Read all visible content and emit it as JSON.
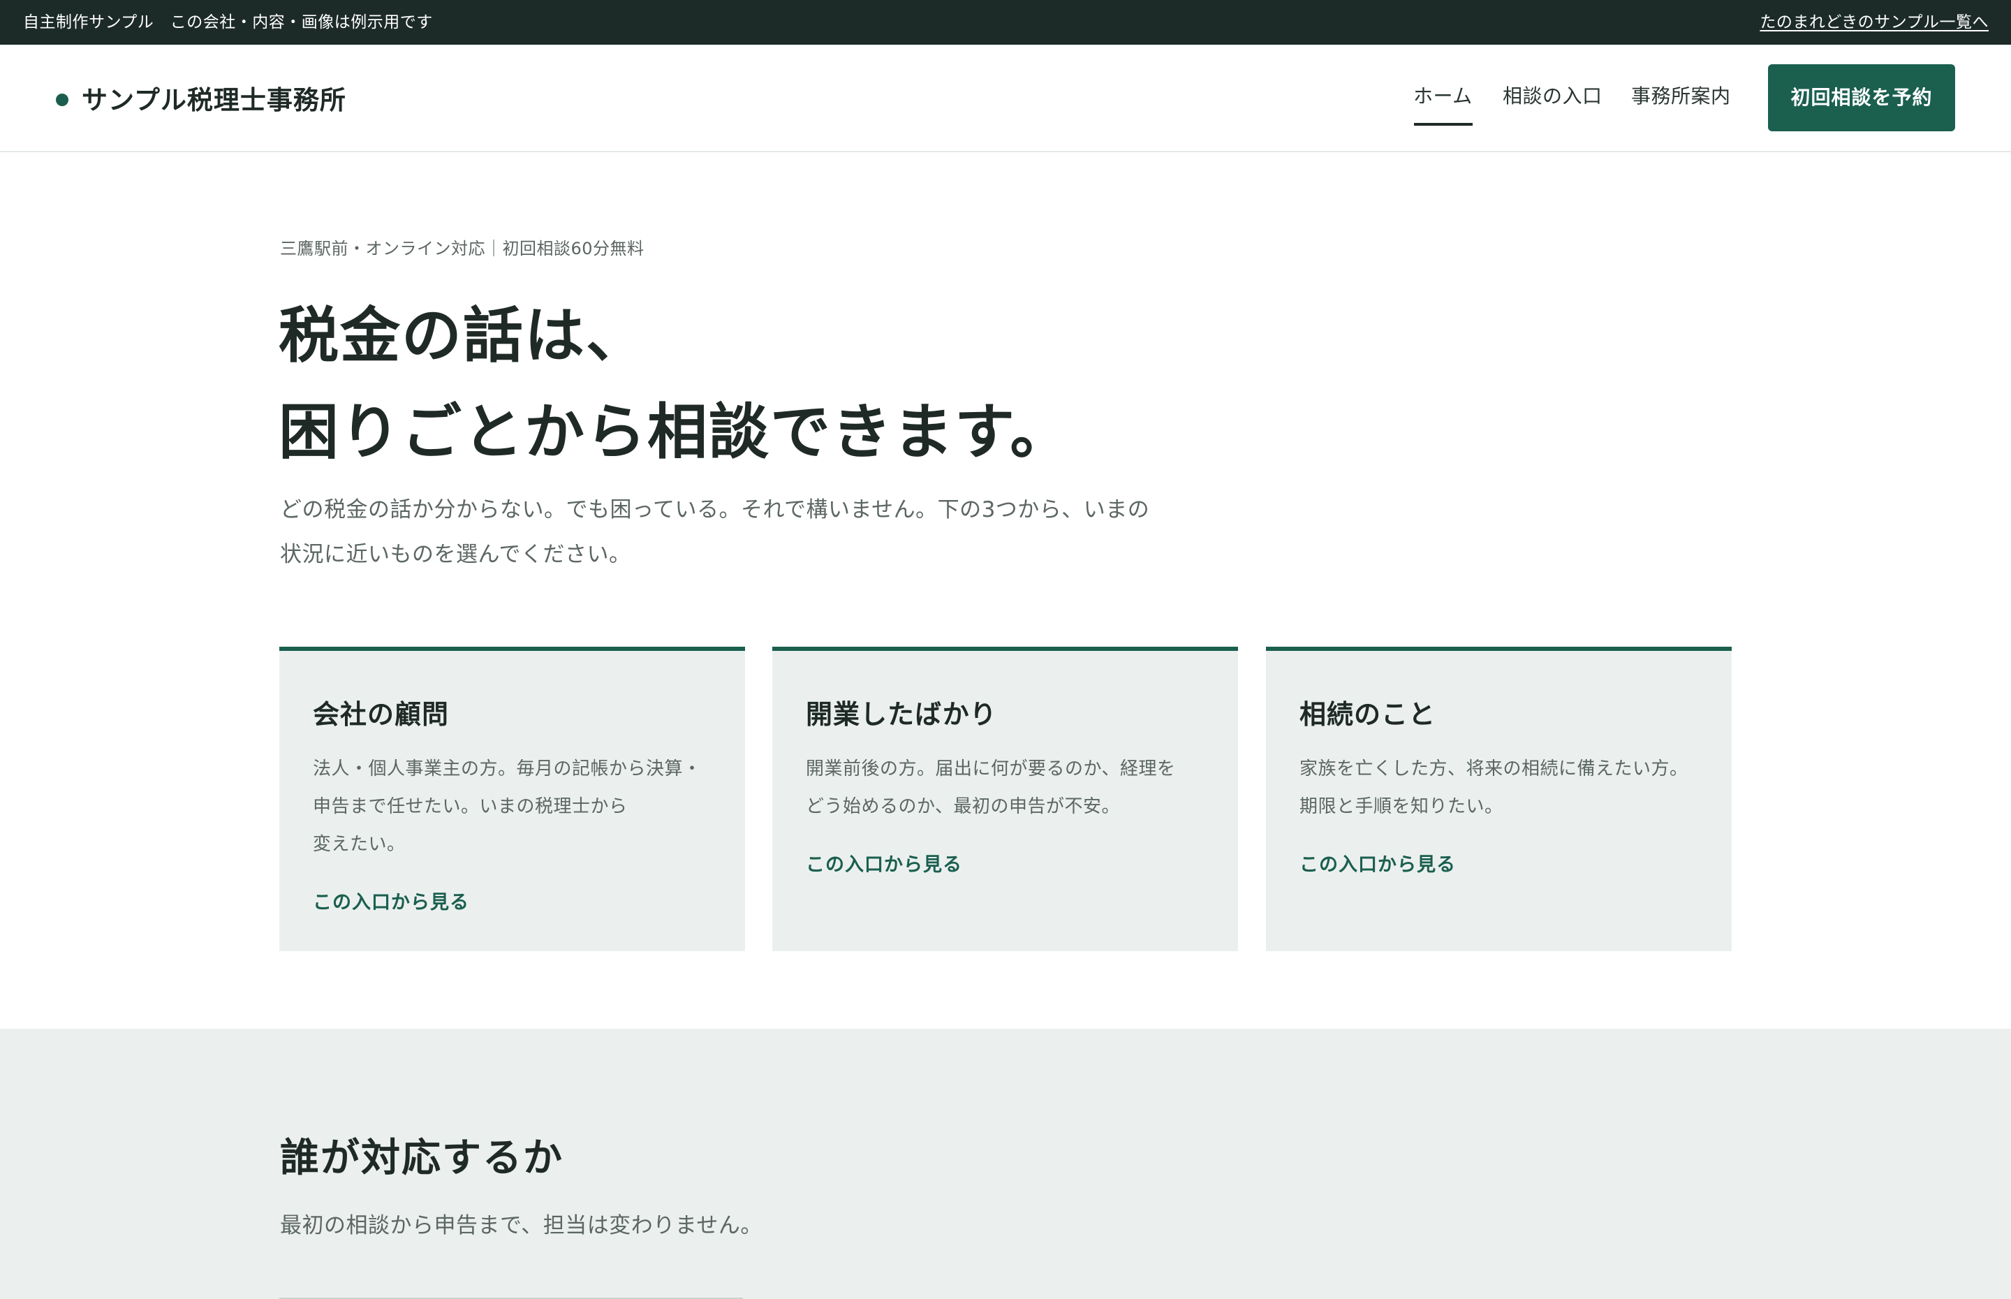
{
  "notice_bar": {
    "text": "自主制作サンプル　この会社・内容・画像は例示用です",
    "link_label": "たのまれどきのサンプル一覧へ"
  },
  "header": {
    "brand_name": "サンプル税理士事務所",
    "nav": [
      {
        "label": "ホーム",
        "active": true
      },
      {
        "label": "相談の入口",
        "active": false
      },
      {
        "label": "事務所案内",
        "active": false
      }
    ],
    "cta_label": "初回相談を予約"
  },
  "hero": {
    "eyebrow": "三鷹駅前・オンライン対応｜初回相談60分無料",
    "title_lines": [
      "税金の話は、",
      "困りごとから相談できます。"
    ],
    "lead_lines": [
      "どの税金の話か分からない。でも困っている。それで構いません。下の3つから、いまの",
      "状況に近いものを選んでください。"
    ]
  },
  "cards": [
    {
      "title": "会社の顧問",
      "desc_lines": [
        "法人・個人事業主の方。毎月の記帳から決算・",
        "申告まで任せたい。いまの税理士から",
        "変えたい。"
      ],
      "link": "この入口から見る"
    },
    {
      "title": "開業したばかり",
      "desc_lines": [
        "開業前後の方。届出に何が要るのか、経理を",
        "どう始めるのか、最初の申告が不安。"
      ],
      "link": "この入口から見る"
    },
    {
      "title": "相続のこと",
      "desc_lines": [
        "家族を亡くした方、将来の相続に備えたい方。",
        "期限と手順を知りたい。"
      ],
      "link": "この入口から見る"
    }
  ],
  "staff_section": {
    "title": "誰が対応するか",
    "lead": "最初の相談から申告まで、担当は変わりません。"
  },
  "colors": {
    "brand_green": "#1b5f4f",
    "dark_bar": "#1d2b28",
    "card_bg": "#ebf0ee",
    "text_dark": "#1f2a27",
    "text_muted": "#5c6663"
  }
}
